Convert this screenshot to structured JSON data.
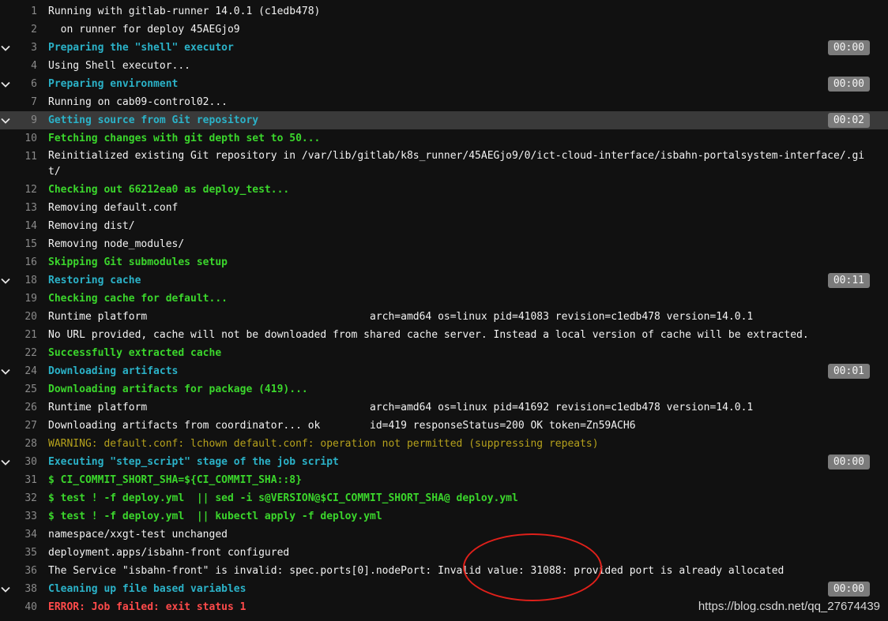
{
  "job_log": {
    "lines": [
      {
        "n": "1",
        "text": "Running with gitlab-runner 14.0.1 (c1edb478)",
        "color": "white"
      },
      {
        "n": "2",
        "text": "  on runner for deploy 45AEGjo9",
        "color": "white"
      },
      {
        "n": "3",
        "text": "Preparing the \"shell\" executor",
        "color": "cyan",
        "section": true,
        "duration": "00:00"
      },
      {
        "n": "4",
        "text": "Using Shell executor...",
        "color": "white"
      },
      {
        "n": "6",
        "text": "Preparing environment",
        "color": "cyan",
        "section": true,
        "duration": "00:00"
      },
      {
        "n": "7",
        "text": "Running on cab09-control02...",
        "color": "white"
      },
      {
        "n": "9",
        "text": "Getting source from Git repository",
        "color": "cyan",
        "section": true,
        "duration": "00:02",
        "highlight": true
      },
      {
        "n": "10",
        "text": "Fetching changes with git depth set to 50...",
        "color": "green"
      },
      {
        "n": "11",
        "text": "Reinitialized existing Git repository in /var/lib/gitlab/k8s_runner/45AEGjo9/0/ict-cloud-interface/isbahn-portalsystem-interface/.git/",
        "color": "white",
        "wrap": true
      },
      {
        "n": "12",
        "text": "Checking out 66212ea0 as deploy_test...",
        "color": "green"
      },
      {
        "n": "13",
        "text": "Removing default.conf",
        "color": "white"
      },
      {
        "n": "14",
        "text": "Removing dist/",
        "color": "white"
      },
      {
        "n": "15",
        "text": "Removing node_modules/",
        "color": "white"
      },
      {
        "n": "16",
        "text": "Skipping Git submodules setup",
        "color": "green"
      },
      {
        "n": "18",
        "text": "Restoring cache",
        "color": "cyan",
        "section": true,
        "duration": "00:11"
      },
      {
        "n": "19",
        "text": "Checking cache for default...",
        "color": "green"
      },
      {
        "n": "20",
        "text": "Runtime platform                                    arch=amd64 os=linux pid=41083 revision=c1edb478 version=14.0.1",
        "color": "white"
      },
      {
        "n": "21",
        "text": "No URL provided, cache will not be downloaded from shared cache server. Instead a local version of cache will be extracted.",
        "color": "white"
      },
      {
        "n": "22",
        "text": "Successfully extracted cache",
        "color": "green"
      },
      {
        "n": "24",
        "text": "Downloading artifacts",
        "color": "cyan",
        "section": true,
        "duration": "00:01"
      },
      {
        "n": "25",
        "text": "Downloading artifacts for package (419)...",
        "color": "green"
      },
      {
        "n": "26",
        "text": "Runtime platform                                    arch=amd64 os=linux pid=41692 revision=c1edb478 version=14.0.1",
        "color": "white"
      },
      {
        "n": "27",
        "text": "Downloading artifacts from coordinator... ok        id=419 responseStatus=200 OK token=Zn59ACH6",
        "color": "white"
      },
      {
        "n": "28",
        "text": "WARNING: default.conf: lchown default.conf: operation not permitted (suppressing repeats)",
        "color": "yellow"
      },
      {
        "n": "30",
        "text": "Executing \"step_script\" stage of the job script",
        "color": "cyan",
        "section": true,
        "duration": "00:00"
      },
      {
        "n": "31",
        "text": "$ CI_COMMIT_SHORT_SHA=${CI_COMMIT_SHA::8}",
        "color": "green"
      },
      {
        "n": "32",
        "text": "$ test ! -f deploy.yml  || sed -i s@VERSION@$CI_COMMIT_SHORT_SHA@ deploy.yml",
        "color": "green"
      },
      {
        "n": "33",
        "text": "$ test ! -f deploy.yml  || kubectl apply -f deploy.yml",
        "color": "green"
      },
      {
        "n": "34",
        "text": "namespace/xxgt-test unchanged",
        "color": "white"
      },
      {
        "n": "35",
        "text": "deployment.apps/isbahn-front configured",
        "color": "white"
      },
      {
        "n": "36",
        "text": "The Service \"isbahn-front\" is invalid: spec.ports[0].nodePort: Invalid value: 31088: provided port is already allocated",
        "color": "white"
      },
      {
        "n": "38",
        "text": "Cleaning up file based variables",
        "color": "cyan",
        "section": true,
        "duration": "00:00"
      },
      {
        "n": "40",
        "text": "ERROR: Job failed: exit status 1",
        "color": "red"
      }
    ]
  },
  "watermark": "https://blog.csdn.net/qq_27674439",
  "colors": {
    "background": "#111111",
    "section_header": "#2bb2c8",
    "success": "#3bd62c",
    "warning": "#b5a11c",
    "error": "#ff4a4a",
    "annotation_circle": "#e0201a"
  }
}
